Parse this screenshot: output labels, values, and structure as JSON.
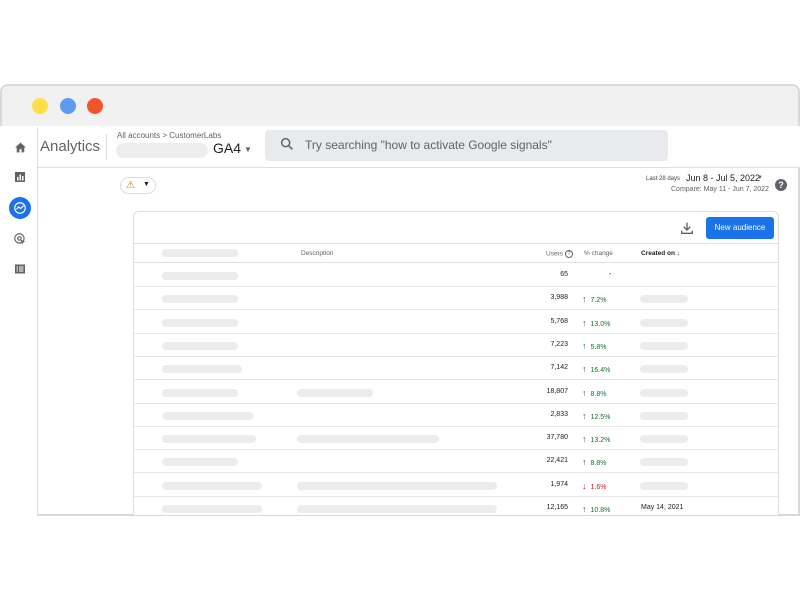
{
  "app": {
    "title": "Analytics",
    "breadcrumb": "All accounts > CustomerLabs",
    "property": "GA4",
    "search_placeholder": "Try searching \"how to activate Google signals\""
  },
  "colors": {
    "accent": "#1a73e8",
    "up": "#137333",
    "down": "#c5221f",
    "logo_orange": "#e37400",
    "logo_yellow": "#f9ab00"
  },
  "rail": [
    "home-icon",
    "reports-icon",
    "explore-icon",
    "advertising-icon",
    "configure-icon"
  ],
  "date": {
    "last_label": "Last 28 days",
    "range": "Jun 8 - Jul 5, 2022",
    "compare": "Compare: May 11 - Jun 7, 2022"
  },
  "toolbar": {
    "new_audience_label": "New audience"
  },
  "table": {
    "headers": {
      "description": "Description",
      "users": "Users",
      "change": "% change",
      "created": "Created on",
      "sort_arrow": "↓"
    },
    "rows": [
      {
        "users": "65",
        "change": "-",
        "dir": "none",
        "created": ""
      },
      {
        "users": "3,988",
        "change": "7.2%",
        "dir": "up",
        "created": ""
      },
      {
        "users": "5,768",
        "change": "13.0%",
        "dir": "up",
        "created": ""
      },
      {
        "users": "7,223",
        "change": "5.8%",
        "dir": "up",
        "created": ""
      },
      {
        "users": "7,142",
        "change": "16.4%",
        "dir": "up",
        "created": ""
      },
      {
        "users": "18,807",
        "change": "8.8%",
        "dir": "up",
        "created": ""
      },
      {
        "users": "2,833",
        "change": "12.5%",
        "dir": "up",
        "created": ""
      },
      {
        "users": "37,780",
        "change": "13.2%",
        "dir": "up",
        "created": ""
      },
      {
        "users": "22,421",
        "change": "8.8%",
        "dir": "up",
        "created": ""
      },
      {
        "users": "1,974",
        "change": "1.6%",
        "dir": "down",
        "created": ""
      },
      {
        "users": "12,165",
        "change": "10.8%",
        "dir": "up",
        "created": "May 14, 2021"
      }
    ]
  }
}
